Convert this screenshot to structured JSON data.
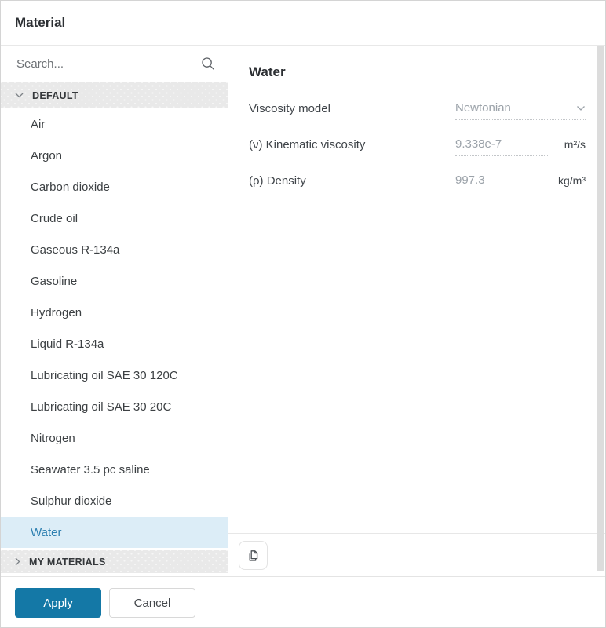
{
  "dialog": {
    "title": "Material"
  },
  "sidebar": {
    "search_placeholder": "Search...",
    "selected_item": "Water",
    "groups": [
      {
        "label": "DEFAULT",
        "expanded": true,
        "items": [
          "Air",
          "Argon",
          "Carbon dioxide",
          "Crude oil",
          "Gaseous R-134a",
          "Gasoline",
          "Hydrogen",
          "Liquid R-134a",
          "Lubricating oil SAE 30 120C",
          "Lubricating oil SAE 30 20C",
          "Nitrogen",
          "Seawater 3.5 pc saline",
          "Sulphur dioxide",
          "Water"
        ]
      },
      {
        "label": "MY MATERIALS",
        "expanded": false,
        "items": []
      }
    ]
  },
  "detail": {
    "title": "Water",
    "fields": [
      {
        "label": "Viscosity model",
        "value": "Newtonian",
        "type": "select",
        "unit": ""
      },
      {
        "label": "(ν) Kinematic viscosity",
        "value": "9.338e-7",
        "type": "input",
        "unit": "m²/s"
      },
      {
        "label": "(ρ) Density",
        "value": "997.3",
        "type": "input",
        "unit": "kg/m³"
      }
    ]
  },
  "footer": {
    "apply_label": "Apply",
    "cancel_label": "Cancel"
  },
  "colors": {
    "accent": "#1478a6",
    "selected_bg": "#dcedf7",
    "selected_text": "#2e80b1"
  }
}
